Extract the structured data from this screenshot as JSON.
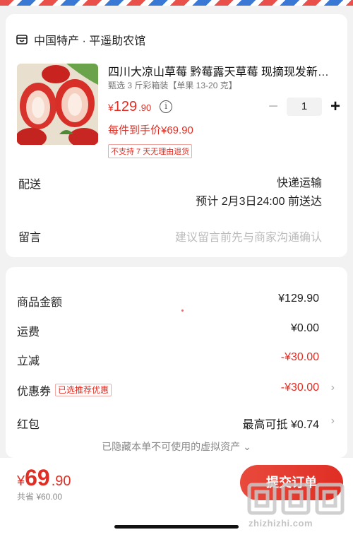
{
  "shop": {
    "name": "中国特产 · 平遥助农馆"
  },
  "product": {
    "title": "四川大凉山草莓 黔莓露天草莓 现摘现发新鲜水果",
    "spec": "甄选 3 斤彩箱装【单果 13-20 克】",
    "price_symbol": "¥",
    "price_int": "129",
    "price_dec": ".90",
    "each_price": "每件到手价¥69.90",
    "tag": "不支持 7 天无理由退货",
    "quantity": "1"
  },
  "delivery": {
    "label": "配送",
    "method": "快递运输",
    "eta": "预计 2月3日24:00 前送达"
  },
  "memo": {
    "label": "留言",
    "placeholder": "建议留言前先与商家沟通确认"
  },
  "fees": {
    "goods_label": "商品金额",
    "goods_value": "¥129.90",
    "shipping_label": "运费",
    "shipping_value": "¥0.00",
    "discount_label": "立减",
    "discount_value": "-¥30.00",
    "coupon_label": "优惠券",
    "coupon_tag": "已选推荐优惠",
    "coupon_value": "-¥30.00",
    "redpacket_label": "红包",
    "redpacket_value": "最高可抵 ¥0.74",
    "hidden_note": "已隐藏本单不可使用的虚拟资产"
  },
  "checkout": {
    "total_symbol": "¥",
    "total_int": "69",
    "total_dec": ".90",
    "saved": "共省 ¥60.00",
    "submit_label": "提交订单"
  },
  "watermark": {
    "text": "zhizhizhi.com"
  },
  "colors": {
    "accent": "#e02e24",
    "background": "#f2f2f2"
  }
}
